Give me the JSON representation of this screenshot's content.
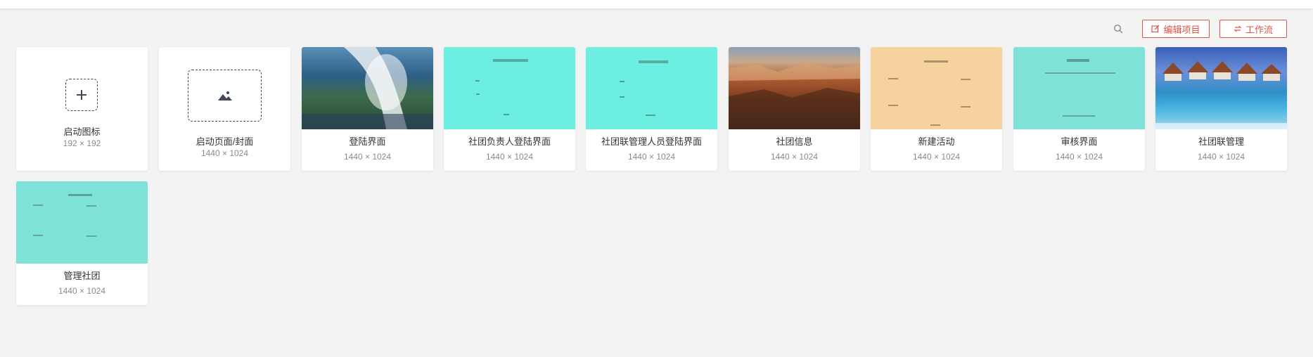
{
  "toolbar": {
    "search_icon": "search-icon",
    "edit_label": "编辑项目",
    "workflow_label": "工作流"
  },
  "colors": {
    "accent": "#e0534a",
    "teal": "#6cefe0",
    "teal_alt": "#7ee2d8",
    "peach": "#f6d29e"
  },
  "cards": [
    {
      "name": "启动图标",
      "size": "192 × 192",
      "type": "app-icon"
    },
    {
      "name": "启动页面/封面",
      "size": "1440 × 1024",
      "type": "cover"
    },
    {
      "name": "登陆界面",
      "size": "1440 × 1024",
      "thumb": "waterfall"
    },
    {
      "name": "社团负责人登陆界面",
      "size": "1440 × 1024",
      "thumb": "teal"
    },
    {
      "name": "社团联管理人员登陆界面",
      "size": "1440 × 1024",
      "thumb": "teal"
    },
    {
      "name": "社团信息",
      "size": "1440 × 1024",
      "thumb": "canyon"
    },
    {
      "name": "新建活动",
      "size": "1440 × 1024",
      "thumb": "peach"
    },
    {
      "name": "审核界面",
      "size": "1440 × 1024",
      "thumb": "teal"
    },
    {
      "name": "社团联管理",
      "size": "1440 × 1024",
      "thumb": "resort"
    },
    {
      "name": "管理社团",
      "size": "1440 × 1024",
      "thumb": "teal"
    }
  ]
}
